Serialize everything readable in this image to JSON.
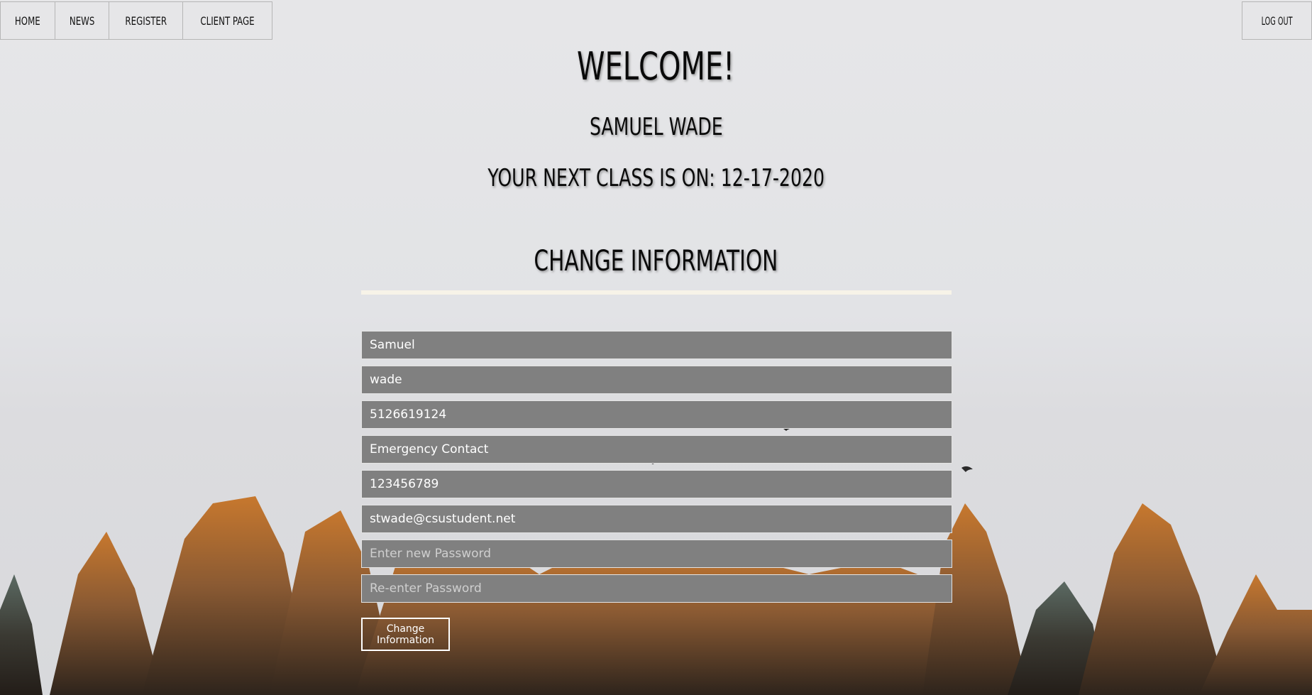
{
  "nav": {
    "left": [
      {
        "label": "HOME"
      },
      {
        "label": "NEWS"
      },
      {
        "label": "REGISTER"
      },
      {
        "label": "CLIENT PAGE"
      }
    ],
    "right": {
      "label": "LOG OUT"
    }
  },
  "header": {
    "welcome": "WELCOME!",
    "user_name": "SAMUEL WADE",
    "next_class": "YOUR NEXT CLASS IS ON: 12-17-2020"
  },
  "form": {
    "title": "CHANGE INFORMATION",
    "fields": [
      {
        "value": "Samuel",
        "placeholder": ""
      },
      {
        "value": "wade",
        "placeholder": ""
      },
      {
        "value": "5126619124",
        "placeholder": ""
      },
      {
        "value": "Emergency Contact",
        "placeholder": ""
      },
      {
        "value": "123456789",
        "placeholder": ""
      },
      {
        "value": "stwade@csustudent.net",
        "placeholder": ""
      },
      {
        "value": "",
        "placeholder": "Enter new Password"
      },
      {
        "value": "",
        "placeholder": "Re-enter Password"
      }
    ],
    "submit_label": "Change Information"
  },
  "colors": {
    "field_bg": "#808080",
    "divider": "#f7f3e8",
    "trees_orange": "#c7782e",
    "trees_dark": "#3a2e24"
  }
}
